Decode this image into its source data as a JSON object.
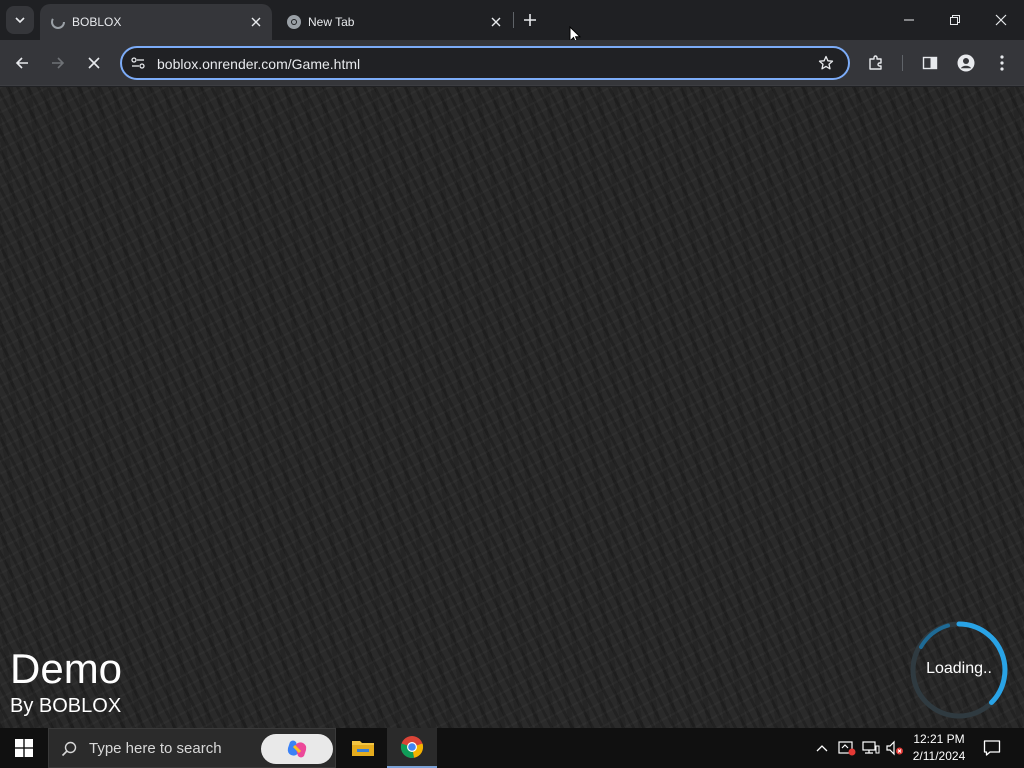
{
  "browser": {
    "tabs": [
      {
        "title": "BOBLOX",
        "active": true
      },
      {
        "title": "New Tab",
        "active": false
      }
    ],
    "url": "boblox.onrender.com/Game.html",
    "colors": {
      "tabstrip": "#1f2023",
      "toolbar": "#35363a",
      "omnibox_border": "#7cacf8"
    }
  },
  "game": {
    "title": "Demo",
    "byline": "By BOBLOX",
    "loading_text": "Loading..",
    "colors": {
      "loader_ring": "#29a3e6"
    }
  },
  "taskbar": {
    "search_placeholder": "Type here to search",
    "time": "12:21 PM",
    "date": "2/11/2024"
  }
}
